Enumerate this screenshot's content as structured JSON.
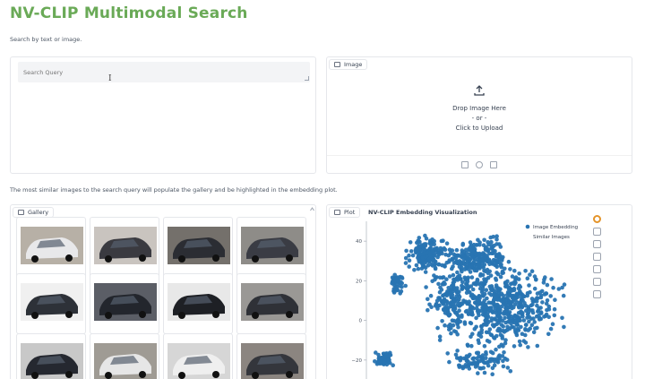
{
  "app": {
    "title": "NV-CLIP Multimodal Search",
    "subtitle": "Search by text or image.",
    "note": "The most similar images to the search query will populate the gallery and be highlighted in the embedding plot."
  },
  "search": {
    "placeholder": "Search Query"
  },
  "image_input": {
    "label": "Image",
    "drop_text": "Drop Image Here",
    "or_text": "- or -",
    "click_text": "Click to Upload",
    "toolbar_icons": [
      "upload-icon",
      "webcam-icon",
      "clipboard-icon"
    ]
  },
  "gallery": {
    "label": "Gallery",
    "items": [
      {
        "name": "white-hatchback",
        "body": "#e8e8ea",
        "bg": "#b7b0a6"
      },
      {
        "name": "blurred-car-roof",
        "body": "#3a3a40",
        "bg": "#c9c4bf"
      },
      {
        "name": "dark-sedan-road",
        "body": "#2b2d33",
        "bg": "#74706b"
      },
      {
        "name": "dark-sedan-motion",
        "body": "#3a3c44",
        "bg": "#8e8c88"
      },
      {
        "name": "dark-hatchback-top",
        "body": "#2d3138",
        "bg": "#f0f0f0"
      },
      {
        "name": "dark-car-night",
        "body": "#23262d",
        "bg": "#5b5e66"
      },
      {
        "name": "black-sedan",
        "body": "#1e2025",
        "bg": "#e8e8e8"
      },
      {
        "name": "dark-car-sign",
        "body": "#2f3137",
        "bg": "#9a9895"
      },
      {
        "name": "dark-car-lot",
        "body": "#252830",
        "bg": "#c8c8c8"
      },
      {
        "name": "white-pickup",
        "body": "#e6e6e6",
        "bg": "#9f9b94"
      },
      {
        "name": "white-van",
        "body": "#efefef",
        "bg": "#d6d6d6"
      },
      {
        "name": "dark-car-debris",
        "body": "#34363c",
        "bg": "#8b8580"
      }
    ]
  },
  "plot": {
    "label": "Plot",
    "title": "NV-CLIP Embedding Visualization",
    "tool_icons": [
      "bokeh-logo-icon",
      "pan-icon",
      "zoom-icon",
      "box-zoom-icon",
      "reset-icon",
      "save-icon",
      "hover-icon"
    ]
  },
  "chart_data": {
    "type": "scatter",
    "title": "NV-CLIP Embedding Visualization",
    "xlabel": "",
    "ylabel": "",
    "ylim": [
      -30,
      50
    ],
    "yticks": [
      "40",
      "20",
      "0",
      "−20"
    ],
    "legend": {
      "placement": "top-right",
      "entries": [
        "Image Embedding",
        "Similar Images"
      ]
    },
    "series": [
      {
        "name": "Image Embedding",
        "color": "#2874b2",
        "points": "dense cluster layout"
      },
      {
        "name": "Similar Images",
        "color": "#f59e0b",
        "points": "none visible"
      }
    ],
    "grid": false
  }
}
